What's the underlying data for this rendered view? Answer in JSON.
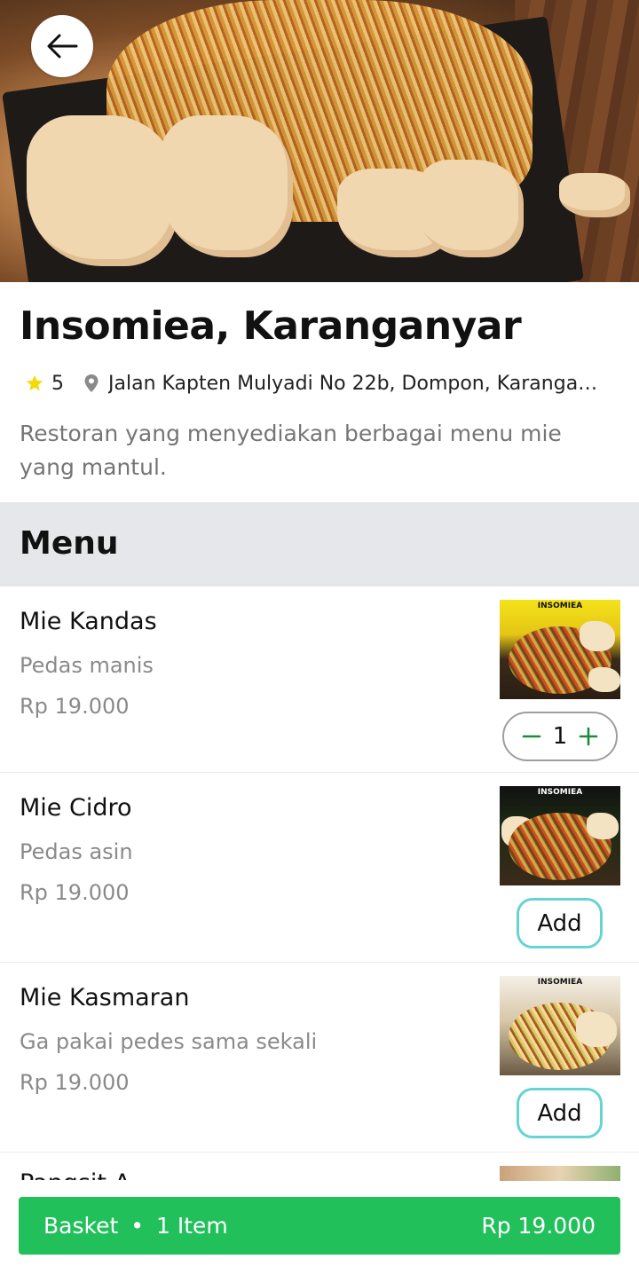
{
  "restaurant": {
    "name": "Insomiea, Karanganyar",
    "rating": "5",
    "address": "Jalan Kapten Mulyadi No 22b, Dompon, Karangany...",
    "description": "Restoran yang menyediakan berbagai menu mie yang mantul."
  },
  "menu": {
    "title": "Menu",
    "items": [
      {
        "name": "Mie Kandas",
        "subtitle": "Pedas manis",
        "price": "Rp 19.000",
        "brand": "INSOMIEA",
        "quantity": "1"
      },
      {
        "name": "Mie Cidro",
        "subtitle": "Pedas asin",
        "price": "Rp 19.000",
        "brand": "INSOMIEA",
        "action": "Add"
      },
      {
        "name": "Mie Kasmaran",
        "subtitle": "Ga pakai pedes sama sekali",
        "price": "Rp 19.000",
        "brand": "INSOMIEA",
        "action": "Add"
      },
      {
        "name": "Pangsit A"
      }
    ]
  },
  "basket": {
    "label": "Basket",
    "separator": "•",
    "count_label": "1 Item",
    "total": "Rp 19.000"
  },
  "colors": {
    "accent_green": "#21c05b",
    "add_border": "#66d4d2",
    "star": "#f5d90a",
    "section_bg": "#e6e7ea"
  },
  "icons": {
    "back": "arrow-left-icon",
    "rating": "star-icon",
    "location": "map-pin-icon",
    "minus": "minus-icon",
    "plus": "plus-icon"
  }
}
